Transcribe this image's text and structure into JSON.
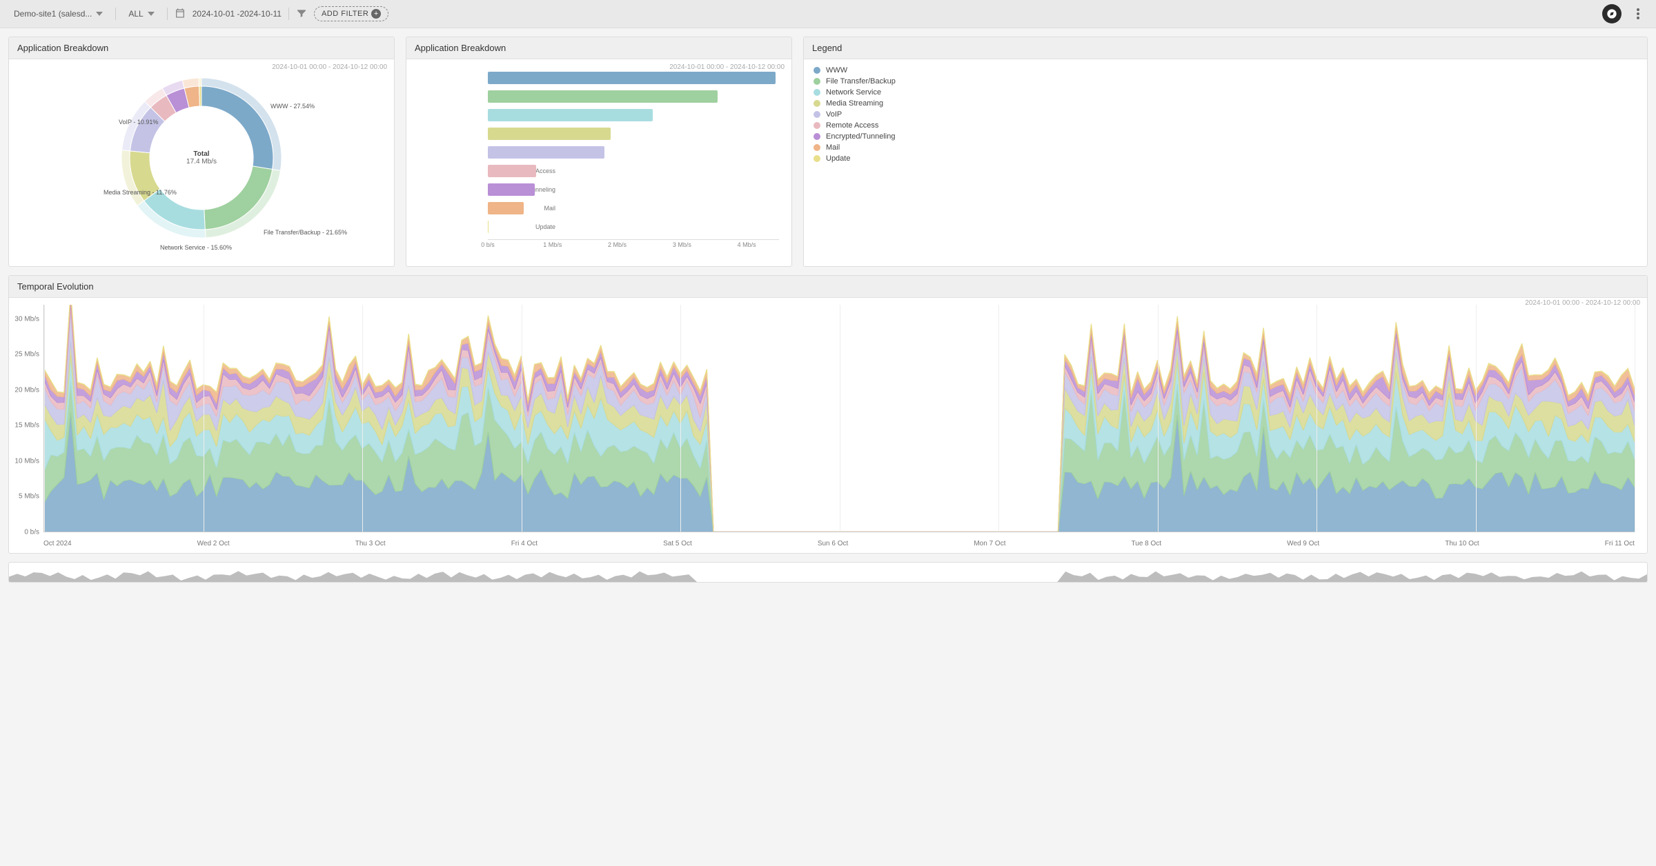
{
  "toolbar": {
    "site_dropdown": "Demo-site1 (salesd...",
    "all_dropdown": "ALL",
    "date_range": "2024-10-01 -2024-10-11",
    "add_filter": "ADD FILTER"
  },
  "panels": {
    "donut": {
      "title": "Application Breakdown",
      "ts": "2024-10-01 00:00 - 2024-10-12 00:00",
      "center_label": "Total",
      "center_value": "17.4 Mb/s"
    },
    "bars": {
      "title": "Application Breakdown",
      "ts": "2024-10-01 00:00 - 2024-10-12 00:00"
    },
    "legend": {
      "title": "Legend"
    },
    "temporal": {
      "title": "Temporal Evolution",
      "ts": "2024-10-01 00:00 - 2024-10-12 00:00"
    }
  },
  "colors": {
    "WWW": "#7da9c9",
    "File Transfer/Backup": "#9fd09f",
    "Network Service": "#a8dde0",
    "Media Streaming": "#d7d98f",
    "VoIP": "#c4c3e6",
    "Remote Access": "#e9b9c0",
    "Encrypted/Tunneling": "#b98fd6",
    "Mail": "#efb487",
    "Update": "#e9df8a"
  },
  "legend_items": [
    "WWW",
    "File Transfer/Backup",
    "Network Service",
    "Media Streaming",
    "VoIP",
    "Remote Access",
    "Encrypted/Tunneling",
    "Mail",
    "Update"
  ],
  "chart_data": {
    "donut": {
      "type": "pie",
      "title": "Application Breakdown",
      "unit": "%",
      "slices": [
        {
          "name": "WWW",
          "value": 27.54,
          "label": "WWW - 27.54%"
        },
        {
          "name": "File Transfer/Backup",
          "value": 21.65,
          "label": "File Transfer/Backup - 21.65%"
        },
        {
          "name": "Network Service",
          "value": 15.6,
          "label": "Network Service - 15.60%"
        },
        {
          "name": "Media Streaming",
          "value": 11.76,
          "label": "Media Streaming - 11.76%"
        },
        {
          "name": "VoIP",
          "value": 10.91,
          "label": "VoIP - 10.91%"
        },
        {
          "name": "Remote Access",
          "value": 4.4,
          "label": ""
        },
        {
          "name": "Encrypted/Tunneling",
          "value": 4.3,
          "label": ""
        },
        {
          "name": "Mail",
          "value": 3.3,
          "label": ""
        },
        {
          "name": "Update",
          "value": 0.54,
          "label": ""
        }
      ],
      "total": "17.4 Mb/s"
    },
    "bars": {
      "type": "bar",
      "orientation": "horizontal",
      "title": "Application Breakdown",
      "xlabel": "",
      "xunit": "Mb/s",
      "xlim": [
        0,
        4.5
      ],
      "xticks": [
        0,
        1,
        2,
        3,
        4
      ],
      "xtick_labels": [
        "0 b/s",
        "1 Mb/s",
        "2 Mb/s",
        "3 Mb/s",
        "4 Mb/s"
      ],
      "categories": [
        "WWW",
        "File Transfer/Backup",
        "Network Service",
        "Media Streaming",
        "VoIP",
        "Remote Access",
        "Encrypted/Tunneling",
        "Mail",
        "Update"
      ],
      "values": [
        4.45,
        3.55,
        2.55,
        1.9,
        1.8,
        0.75,
        0.73,
        0.55,
        0.01
      ]
    },
    "temporal": {
      "type": "area",
      "stacked": true,
      "title": "Temporal Evolution",
      "yunit": "Mb/s",
      "ylim": [
        0,
        32
      ],
      "yticks": [
        0,
        5,
        10,
        15,
        20,
        25,
        30
      ],
      "ytick_labels": [
        "0 b/s",
        "5 Mb/s",
        "10 Mb/s",
        "15 Mb/s",
        "20 Mb/s",
        "25 Mb/s",
        "30 Mb/s"
      ],
      "x_labels": [
        "Oct 2024",
        "Wed 2 Oct",
        "Thu 3 Oct",
        "Fri 4 Oct",
        "Sat 5 Oct",
        "Sun 6 Oct",
        "Mon 7 Oct",
        "Tue 8 Oct",
        "Wed 9 Oct",
        "Thu 10 Oct",
        "Fri 11 Oct"
      ],
      "gap": {
        "from": "Sat 5 Oct",
        "to": "Tue 8 Oct"
      },
      "series": [
        {
          "name": "WWW",
          "avg": 6.5,
          "peak": 11
        },
        {
          "name": "File Transfer/Backup",
          "avg": 5.0,
          "peak": 9
        },
        {
          "name": "Network Service",
          "avg": 3.2,
          "peak": 6
        },
        {
          "name": "Media Streaming",
          "avg": 2.2,
          "peak": 4
        },
        {
          "name": "VoIP",
          "avg": 2.0,
          "peak": 3.5
        },
        {
          "name": "Remote Access",
          "avg": 0.9,
          "peak": 2
        },
        {
          "name": "Encrypted/Tunneling",
          "avg": 0.9,
          "peak": 2
        },
        {
          "name": "Mail",
          "avg": 0.7,
          "peak": 1.5
        },
        {
          "name": "Update",
          "avg": 0.1,
          "peak": 0.3
        }
      ],
      "total_avg": 21.5,
      "total_peak": 31
    }
  }
}
